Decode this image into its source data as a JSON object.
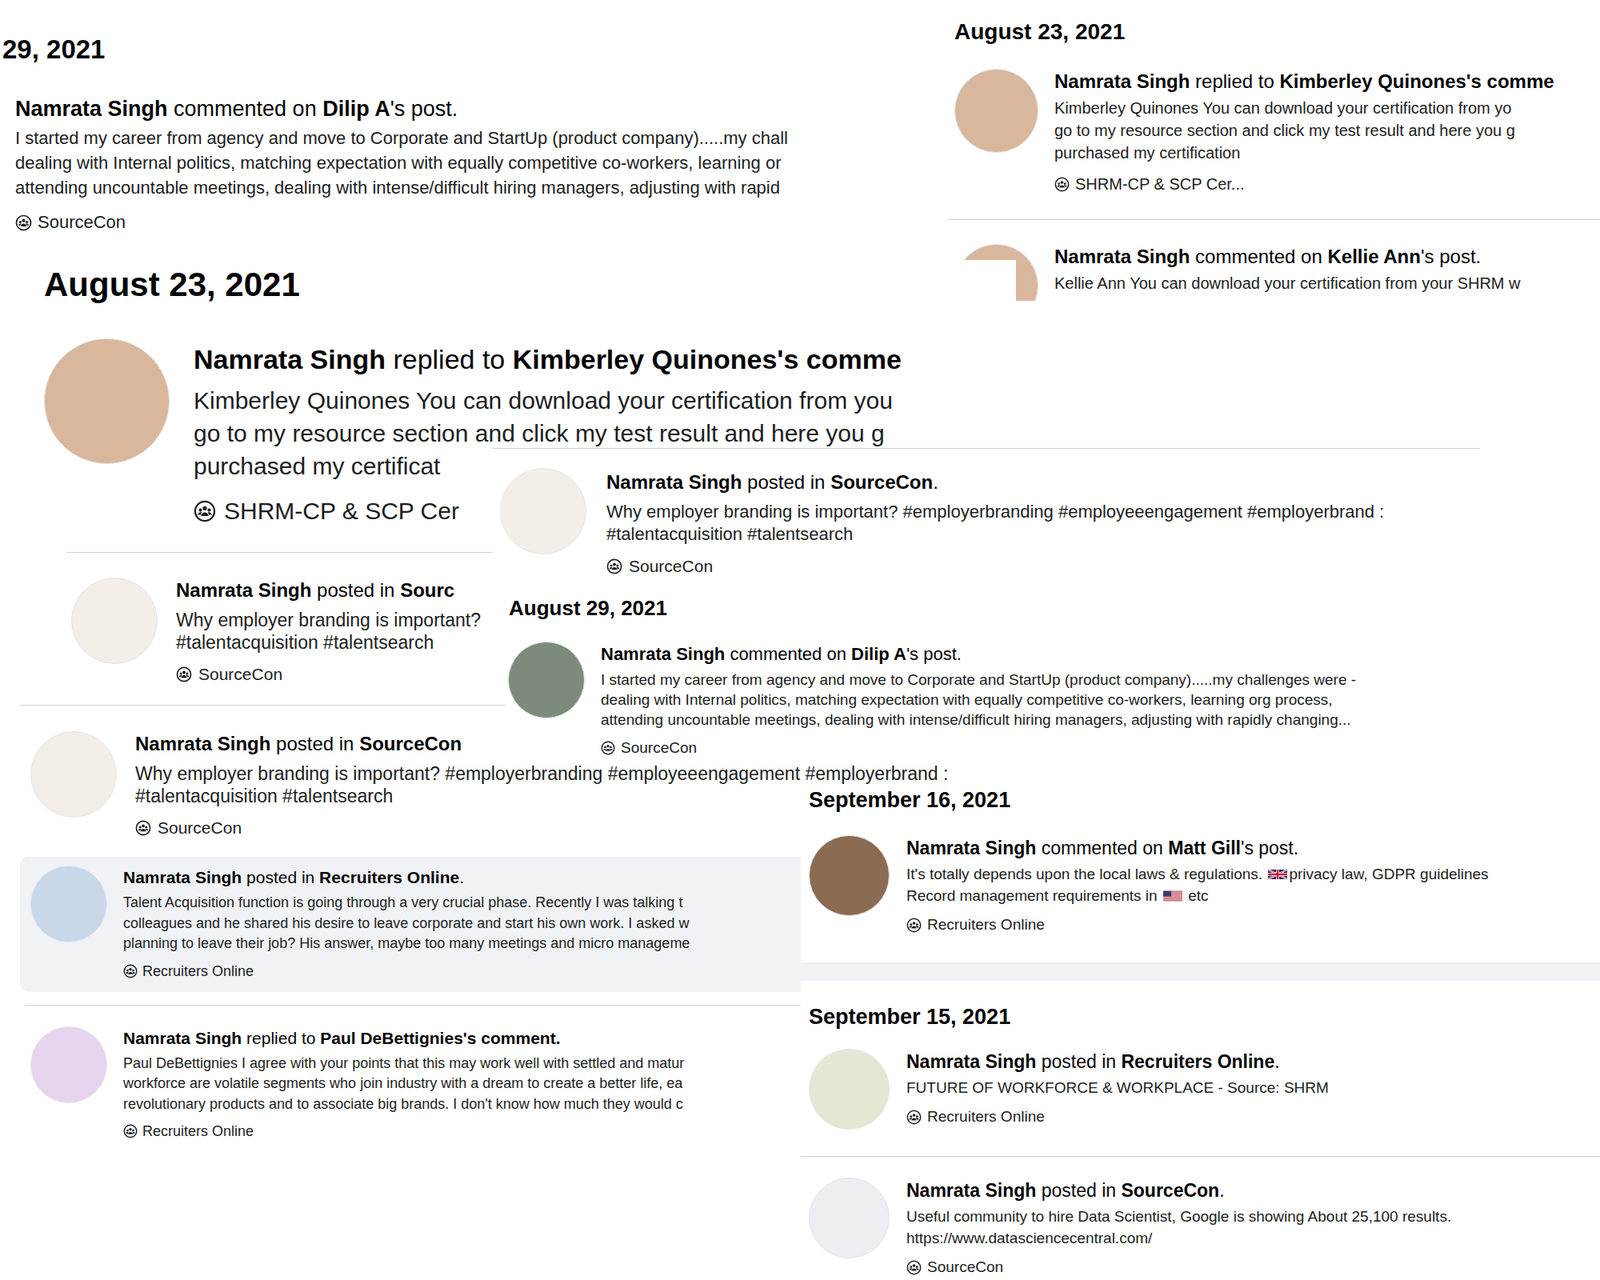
{
  "fragments": [
    {
      "sections": [
        {
          "date": "29, 2021",
          "entries": [
            {
              "title": [
                {
                  "text": "Namrata Singh",
                  "bold": true
                },
                {
                  "text": " commented on ",
                  "bold": false
                },
                {
                  "text": "Dilip A",
                  "bold": true
                },
                {
                  "text": "'s post.",
                  "bold": false
                }
              ],
              "body": [
                "I started my career from agency and move to Corporate and StartUp (product company).....my chall",
                "dealing with Internal politics, matching expectation with equally competitive co-workers, learning or",
                "attending uncountable meetings, dealing with intense/difficult hiring managers, adjusting with rapid"
              ],
              "group": "SourceCon",
              "highlighted": false
            }
          ]
        }
      ]
    },
    {
      "sections": [
        {
          "date": "August 23, 2021",
          "entries": [
            {
              "title": [
                {
                  "text": "Namrata Singh",
                  "bold": true
                },
                {
                  "text": " replied to ",
                  "bold": false
                },
                {
                  "text": "Kimberley Quinones's comme",
                  "bold": true
                }
              ],
              "body": [
                "Kimberley Quinones You can download your certification from yo",
                "go to my resource section and click my test result and here you g",
                "purchased my certification"
              ],
              "group": "SHRM-CP & SCP Cer...",
              "highlighted": false,
              "avatar_color": "#d9b79c"
            },
            {
              "title": [
                {
                  "text": "Namrata Singh",
                  "bold": true
                },
                {
                  "text": " commented on ",
                  "bold": false
                },
                {
                  "text": "Kellie Ann",
                  "bold": true
                },
                {
                  "text": "'s post.",
                  "bold": false
                }
              ],
              "body": [
                "Kellie Ann You can download your certification from your SHRM w"
              ],
              "highlighted": false,
              "avatar_color": "#d9b79c"
            }
          ]
        }
      ]
    },
    {
      "sections": [
        {
          "date": "August 23, 2021",
          "entries": [
            {
              "title": [
                {
                  "text": "Namrata Singh",
                  "bold": true
                },
                {
                  "text": " replied to ",
                  "bold": false
                },
                {
                  "text": "Kimberley Quinones's comme",
                  "bold": true
                }
              ],
              "body": [
                "Kimberley Quinones You can download your certification from you",
                "go to my resource section and click my test result and here you g",
                "purchased my certificat"
              ],
              "group": "SHRM-CP & SCP Cer",
              "highlighted": false,
              "avatar_color": "#d9b79c"
            }
          ]
        }
      ]
    },
    {
      "sections": [
        {
          "entries": [
            {
              "title": [
                {
                  "text": "Namrata Singh",
                  "bold": true
                },
                {
                  "text": " posted in ",
                  "bold": false
                },
                {
                  "text": "Sourc",
                  "bold": true
                }
              ],
              "body": [
                "Why employer branding is important?",
                "#talentacquisition #talentsearch"
              ],
              "group": "SourceCon",
              "highlighted": false,
              "avatar_color": "#f3eee7"
            },
            {
              "title": [
                {
                  "text": "Namrata Singh",
                  "bold": true
                },
                {
                  "text": " posted in ",
                  "bold": false
                },
                {
                  "text": "SourceCon",
                  "bold": true
                }
              ],
              "body": [
                "Why employer branding is important? #employerbranding #employeeengagement #employerbrand :",
                "#talentacquisition #talentsearch"
              ],
              "group": "SourceCon",
              "highlighted": false,
              "avatar_color": "#f3eee7"
            }
          ]
        }
      ]
    },
    {
      "sections": [
        {
          "entries": [
            {
              "title": [
                {
                  "text": "Namrata Singh",
                  "bold": true
                },
                {
                  "text": " posted in ",
                  "bold": false
                },
                {
                  "text": "Recruiters Online",
                  "bold": true
                },
                {
                  "text": ".",
                  "bold": false
                }
              ],
              "body": [
                "Talent Acquisition function is going through a very crucial phase. Recently I was talking t",
                "colleagues and he shared his desire to leave corporate and start his own work. I asked w",
                "planning to leave their job? His answer, maybe too many meetings and micro manageme"
              ],
              "group": "Recruiters Online",
              "highlighted": true,
              "avatar_color": "#c9d8e8"
            },
            {
              "title": [
                {
                  "text": "Namrata Singh",
                  "bold": true
                },
                {
                  "text": " replied to ",
                  "bold": false
                },
                {
                  "text": "Paul DeBettignies's comment.",
                  "bold": true
                }
              ],
              "body": [
                "Paul DeBettignies I agree with your points that this may work well with settled and matur",
                "workforce are volatile segments who join industry with a dream to create a better life, ea",
                "revolutionary products and to associate big brands. I don't know how much they would c"
              ],
              "group": "Recruiters Online",
              "highlighted": false,
              "avatar_color": "#e6d3ee"
            }
          ]
        }
      ]
    },
    {
      "sections": [
        {
          "entries": [
            {
              "title": [
                {
                  "text": "Namrata Singh",
                  "bold": true
                },
                {
                  "text": " posted in ",
                  "bold": false
                },
                {
                  "text": "SourceCon",
                  "bold": true
                },
                {
                  "text": ".",
                  "bold": false
                }
              ],
              "body": [
                "Why employer branding is important? #employerbranding #employeeengagement #employerbrand :",
                "#talentacquisition #talentsearch"
              ],
              "group": "SourceCon",
              "highlighted": false,
              "avatar_color": "#f3eee7"
            }
          ]
        }
      ]
    },
    {
      "sections": [
        {
          "date": "August 29, 2021",
          "entries": [
            {
              "title": [
                {
                  "text": "Namrata Singh",
                  "bold": true
                },
                {
                  "text": " commented on ",
                  "bold": false
                },
                {
                  "text": "Dilip A",
                  "bold": true
                },
                {
                  "text": "'s post.",
                  "bold": false
                }
              ],
              "body": [
                "I started my career from agency and move to Corporate and StartUp (product company).....my challenges were -",
                "dealing with Internal politics, matching expectation with equally competitive co-workers, learning org process,",
                "attending uncountable meetings, dealing with intense/difficult hiring managers, adjusting with rapidly changing..."
              ],
              "group": "SourceCon",
              "highlighted": false,
              "avatar_color": "#7d8c7a"
            }
          ]
        }
      ]
    },
    {
      "sections": [
        {
          "date": "September 16, 2021",
          "entries": [
            {
              "title": [
                {
                  "text": "Namrata Singh",
                  "bold": true
                },
                {
                  "text": " commented on ",
                  "bold": false
                },
                {
                  "text": "Matt Gill",
                  "bold": true
                },
                {
                  "text": "'s post.",
                  "bold": false
                }
              ],
              "body": [
                [
                  {
                    "kind": "text",
                    "text": "It's totally depends upon the local laws & regulations. "
                  },
                  {
                    "kind": "flag-uk"
                  },
                  {
                    "kind": "text",
                    "text": "privacy law, GDPR guidelines"
                  }
                ],
                [
                  {
                    "kind": "text",
                    "text": "Record management requirements in "
                  },
                  {
                    "kind": "flag-us"
                  },
                  {
                    "kind": "text",
                    "text": " etc"
                  }
                ]
              ],
              "group": "Recruiters Online",
              "highlighted": false,
              "avatar_color": "#8b6b52"
            }
          ]
        },
        {
          "date": "September 15, 2021",
          "entries": [
            {
              "title": [
                {
                  "text": "Namrata Singh",
                  "bold": true
                },
                {
                  "text": " posted in ",
                  "bold": false
                },
                {
                  "text": "Recruiters Online",
                  "bold": true
                },
                {
                  "text": ".",
                  "bold": false
                }
              ],
              "body": [
                "FUTURE OF WORKFORCE & WORKPLACE - Source: SHRM"
              ],
              "group": "Recruiters Online",
              "highlighted": false,
              "avatar_color": "#e2e8d2"
            },
            {
              "title": [
                {
                  "text": "Namrata Singh",
                  "bold": true
                },
                {
                  "text": " posted in ",
                  "bold": false
                },
                {
                  "text": "SourceCon",
                  "bold": true
                },
                {
                  "text": ".",
                  "bold": false
                }
              ],
              "body": [
                "Useful community to hire Data Scientist, Google is showing About 25,100 results.",
                "https://www.datasciencecentral.com/"
              ],
              "group": "SourceCon",
              "highlighted": false,
              "avatar_color": "#eceef2"
            }
          ]
        }
      ]
    }
  ]
}
